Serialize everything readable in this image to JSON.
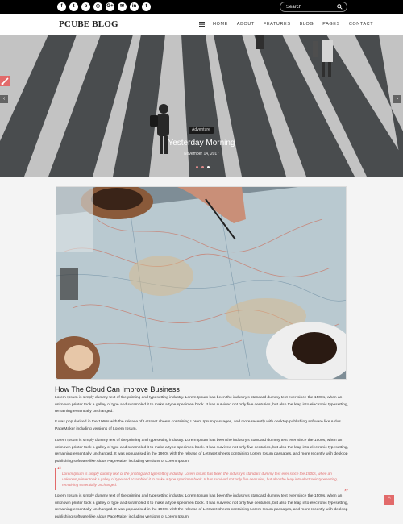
{
  "topbar": {
    "social": [
      {
        "icon": "facebook-icon",
        "glyph": "f"
      },
      {
        "icon": "twitter-icon",
        "glyph": "t"
      },
      {
        "icon": "pinterest-icon",
        "glyph": "p"
      },
      {
        "icon": "instagram-icon",
        "glyph": "◎"
      },
      {
        "icon": "google-plus-icon",
        "glyph": "G+"
      },
      {
        "icon": "email-icon",
        "glyph": "✉"
      },
      {
        "icon": "linkedin-icon",
        "glyph": "in"
      },
      {
        "icon": "tumblr-icon",
        "glyph": "t"
      }
    ],
    "search_placeholder": "Search"
  },
  "nav": {
    "logo": "PCUBE BLOG",
    "items": [
      "HOME",
      "ABOUT",
      "FEATURES",
      "BLOG",
      "PAGES",
      "CONTACT"
    ]
  },
  "hero": {
    "category": "Adventure",
    "title": "Yesterday Morning",
    "date": "November 14, 2017",
    "prev": "‹",
    "next": "›"
  },
  "post": {
    "title": "How The Cloud Can Improve Business",
    "p1": "Lorem Ipsum is simply dummy text of the printing and typesetting industry. Lorem Ipsum has been the industry's standard dummy text ever since the 1500s, when an unknown printer took a galley of type and scrambled it to make a type specimen book. It has survived not only five centuries, but also the leap into electronic typesetting, remaining essentially unchanged.",
    "p2": "It was popularised in the 1960s with the release of Letraset sheets containing Lorem Ipsum passages, and more recently with desktop publishing software like Aldus PageMaker including versions of Lorem Ipsum.",
    "p3": "Lorem Ipsum is simply dummy text of the printing and typesetting industry. Lorem Ipsum has been the industry's standard dummy text ever since the 1500s, when an unknown printer took a galley of type and scrambled it to make a type specimen book. It has survived not only five centuries, but also the leap into electronic typesetting, remaining essentially unchanged. It was popularised in the 1960s with the release of Letraset sheets containing Lorem Ipsum passages, and more recently with desktop publishing software like Aldus PageMaker including versions of Lorem Ipsum.",
    "quote": "Lorem Ipsum is simply dummy text of the printing and typesetting industry. Lorem Ipsum has been the industry's standard dummy text ever since the 1500s, when an unknown printer took a galley of type and scrambled it to make a type specimen book. It has survived not only five centuries, but also the leap into electronic typesetting, remaining essentially unchanged.",
    "p4": "Lorem Ipsum is simply dummy text of the printing and typesetting industry. Lorem Ipsum has been the industry's standard dummy text ever since the 1500s, when an unknown printer took a galley of type and scrambled it to make a type specimen book. It has survived not only five centuries, but also the leap into electronic typesetting, remaining essentially unchanged. It was popularised in the 1960s with the release of Letraset sheets containing Lorem Ipsum passages, and more recently with desktop publishing software like Aldus PageMaker including versions of Lorem Ipsum."
  },
  "colors": {
    "accent": "#e26a6a",
    "topbar": "#000000"
  },
  "totop": "^"
}
